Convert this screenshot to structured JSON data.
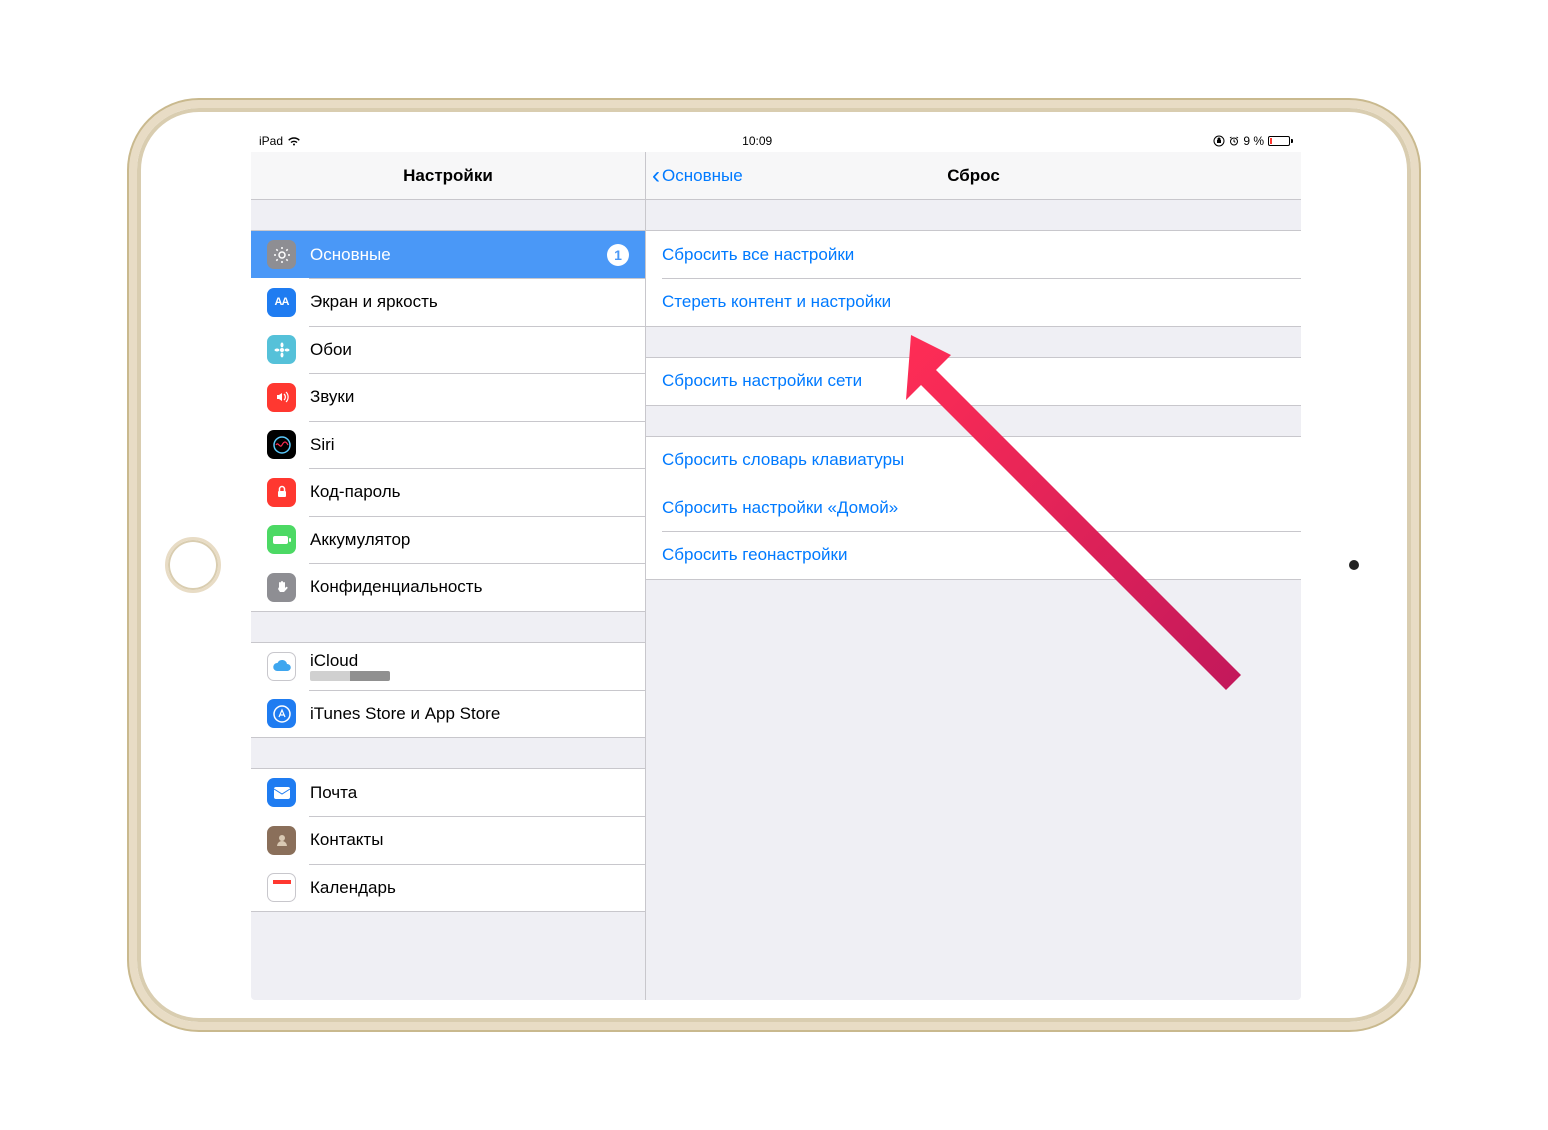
{
  "status": {
    "device": "iPad",
    "time": "10:09",
    "battery": "9 %"
  },
  "sidebar": {
    "title": "Настройки",
    "groups": [
      [
        {
          "key": "general",
          "label": "Основные",
          "badge": "1",
          "selected": true
        },
        {
          "key": "display",
          "label": "Экран и яркость"
        },
        {
          "key": "wallpaper",
          "label": "Обои"
        },
        {
          "key": "sounds",
          "label": "Звуки"
        },
        {
          "key": "siri",
          "label": "Siri"
        },
        {
          "key": "passcode",
          "label": "Код-пароль"
        },
        {
          "key": "battery",
          "label": "Аккумулятор"
        },
        {
          "key": "privacy",
          "label": "Конфиденциальность"
        }
      ],
      [
        {
          "key": "icloud",
          "label": "iCloud"
        },
        {
          "key": "itunes",
          "label": "iTunes Store и App Store"
        }
      ],
      [
        {
          "key": "mail",
          "label": "Почта"
        },
        {
          "key": "contacts",
          "label": "Контакты"
        },
        {
          "key": "calendar",
          "label": "Календарь"
        }
      ]
    ]
  },
  "detail": {
    "back": "Основные",
    "title": "Сброс",
    "groups": [
      [
        {
          "label": "Сбросить все настройки"
        },
        {
          "label": "Стереть контент и настройки"
        }
      ],
      [
        {
          "label": "Сбросить настройки сети"
        }
      ],
      [
        {
          "label": "Сбросить словарь клавиатуры"
        },
        {
          "label": "Сбросить настройки «Домой»"
        },
        {
          "label": "Сбросить геонастройки"
        }
      ]
    ]
  },
  "icons": {
    "general": "gear",
    "display": "AA",
    "wallpaper": "flower",
    "sounds": "speaker",
    "siri": "siri",
    "passcode": "lock",
    "battery": "battery",
    "privacy": "hand",
    "icloud": "cloud",
    "itunes": "appstore",
    "mail": "envelope",
    "contacts": "person",
    "calendar": "calendar"
  }
}
